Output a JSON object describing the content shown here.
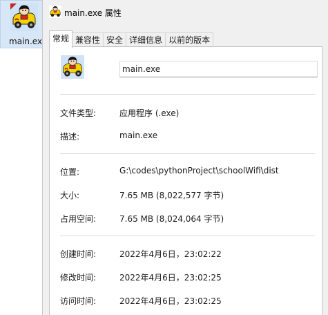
{
  "desktop": {
    "icon_label": "main.exe"
  },
  "window": {
    "title": "main.exe 属性"
  },
  "tabs": [
    {
      "label": "常规",
      "active": true
    },
    {
      "label": "兼容性"
    },
    {
      "label": "安全"
    },
    {
      "label": "详细信息"
    },
    {
      "label": "以前的版本"
    }
  ],
  "general": {
    "file_name": "main.exe",
    "rows": [
      {
        "label": "文件类型:",
        "value": "应用程序 (.exe)"
      },
      {
        "label": "描述:",
        "value": "main.exe"
      },
      {
        "label": "位置:",
        "value": "G:\\codes\\pythonProject\\schoolWifi\\dist"
      },
      {
        "label": "大小:",
        "value": "7.65 MB (8,022,577 字节)"
      },
      {
        "label": "占用空间:",
        "value": "7.65 MB (8,024,064 字节)"
      },
      {
        "label": "创建时间:",
        "value": "2022年4月6日，23:02:22"
      },
      {
        "label": "修改时间:",
        "value": "2022年4月6日，23:02:25"
      },
      {
        "label": "访问时间:",
        "value": "2022年4月6日，23:02:25"
      }
    ]
  },
  "icon": "cartoon-car-icon"
}
